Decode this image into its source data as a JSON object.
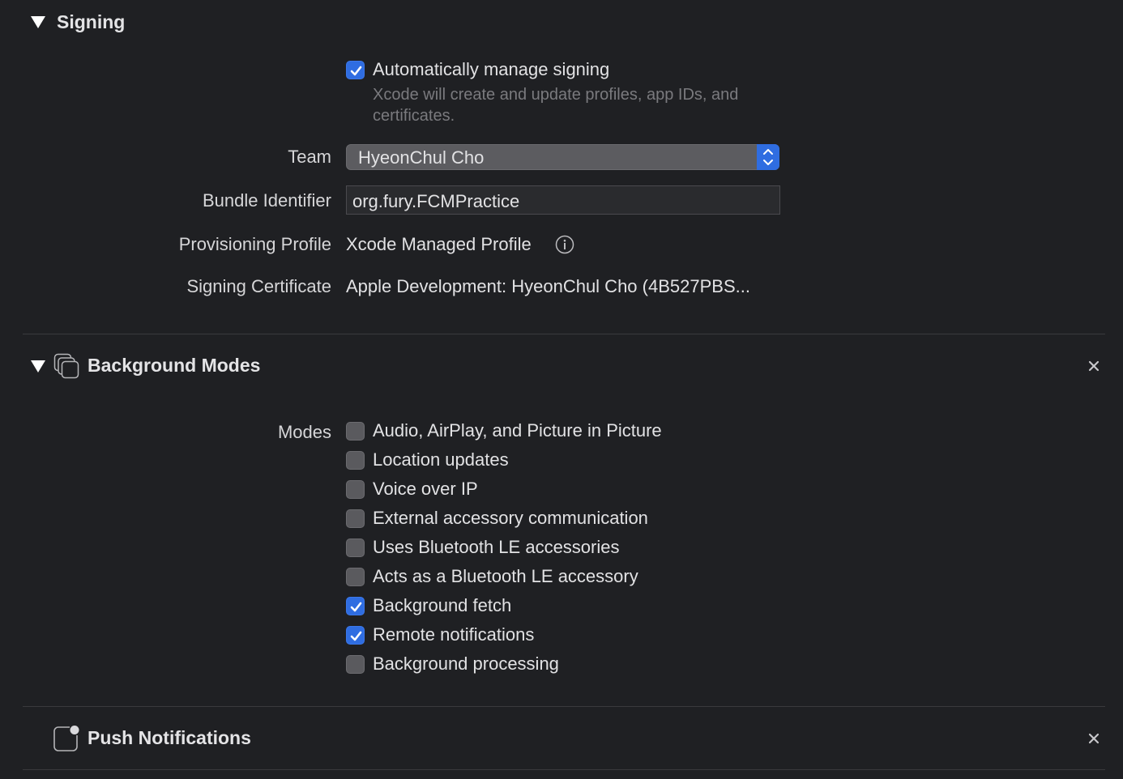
{
  "signing": {
    "title": "Signing",
    "auto_manage_label": "Automatically manage signing",
    "auto_manage_checked": true,
    "auto_manage_help": "Xcode will create and update profiles, app IDs, and certificates.",
    "team_label": "Team",
    "team_value": "HyeonChul Cho",
    "bundle_label": "Bundle Identifier",
    "bundle_value": "org.fury.FCMPractice",
    "profile_label": "Provisioning Profile",
    "profile_value": "Xcode Managed Profile",
    "certificate_label": "Signing Certificate",
    "certificate_value": "Apple Development: HyeonChul Cho (4B527PBS..."
  },
  "background_modes": {
    "title": "Background Modes",
    "modes_label": "Modes",
    "modes": [
      {
        "label": "Audio, AirPlay, and Picture in Picture",
        "checked": false
      },
      {
        "label": "Location updates",
        "checked": false
      },
      {
        "label": "Voice over IP",
        "checked": false
      },
      {
        "label": "External accessory communication",
        "checked": false
      },
      {
        "label": "Uses Bluetooth LE accessories",
        "checked": false
      },
      {
        "label": "Acts as a Bluetooth LE accessory",
        "checked": false
      },
      {
        "label": "Background fetch",
        "checked": true
      },
      {
        "label": "Remote notifications",
        "checked": true
      },
      {
        "label": "Background processing",
        "checked": false
      }
    ]
  },
  "push_notifications": {
    "title": "Push Notifications"
  },
  "colors": {
    "background": "#1f2023",
    "accent": "#2f6de1"
  }
}
